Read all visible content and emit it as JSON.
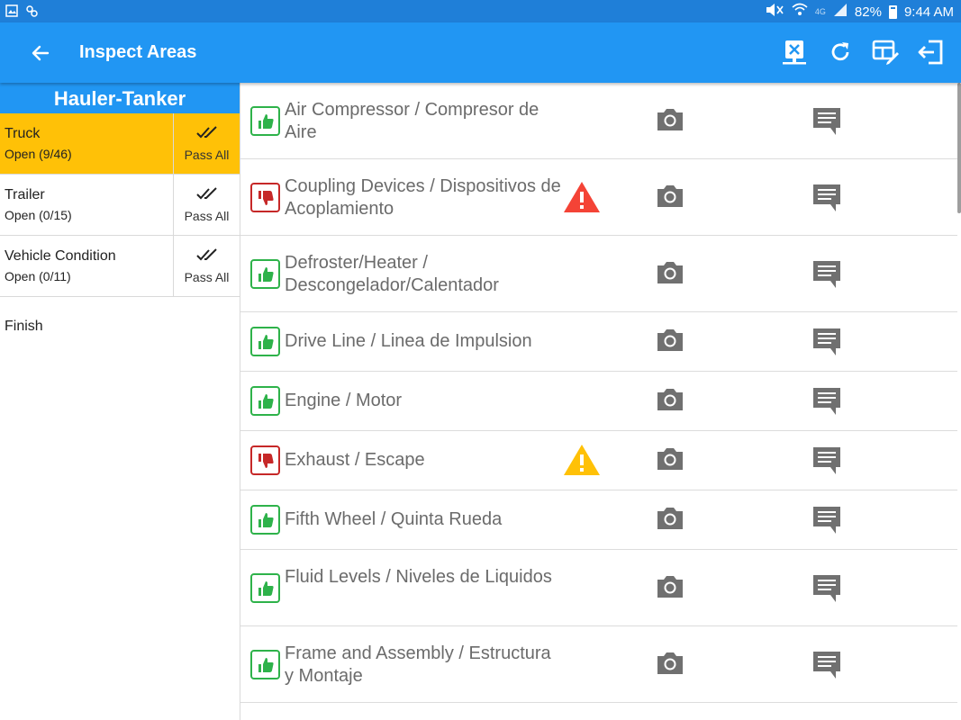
{
  "status_bar": {
    "battery": "82%",
    "time": "9:44 AM",
    "network": "4G"
  },
  "app_bar": {
    "title": "Inspect Areas"
  },
  "colors": {
    "primary": "#2196f3",
    "active_area": "#ffc107",
    "pass": "#2eb24a",
    "fail": "#c62828"
  },
  "left_panel": {
    "header": "Hauler-Tanker",
    "areas": [
      {
        "name": "Truck",
        "status": "Open (9/46)",
        "pass_all": "Pass All"
      },
      {
        "name": "Trailer",
        "status": "Open (0/15)",
        "pass_all": "Pass All"
      },
      {
        "name": "Vehicle Condition",
        "status": "Open (0/11)",
        "pass_all": "Pass All"
      }
    ],
    "finish": "Finish"
  },
  "items": [
    {
      "label": "Air Compressor / Compresor de Aire",
      "result": "pass"
    },
    {
      "label": "Coupling Devices / Dispositivos de Acoplamiento",
      "result": "fail",
      "warning": "red"
    },
    {
      "label": "Defroster/Heater / Descongelador/Calentador",
      "result": "pass"
    },
    {
      "label": "Drive Line / Linea de Impulsion",
      "result": "pass"
    },
    {
      "label": "Engine / Motor",
      "result": "pass"
    },
    {
      "label": "Exhaust / Escape",
      "result": "fail",
      "warning": "yellow"
    },
    {
      "label": "Fifth Wheel / Quinta Rueda",
      "result": "pass"
    },
    {
      "label": "Fluid Levels / Niveles de Liquidos",
      "result": "pass"
    },
    {
      "label": "Frame and Assembly / Estructura y Montaje",
      "result": "pass"
    }
  ]
}
